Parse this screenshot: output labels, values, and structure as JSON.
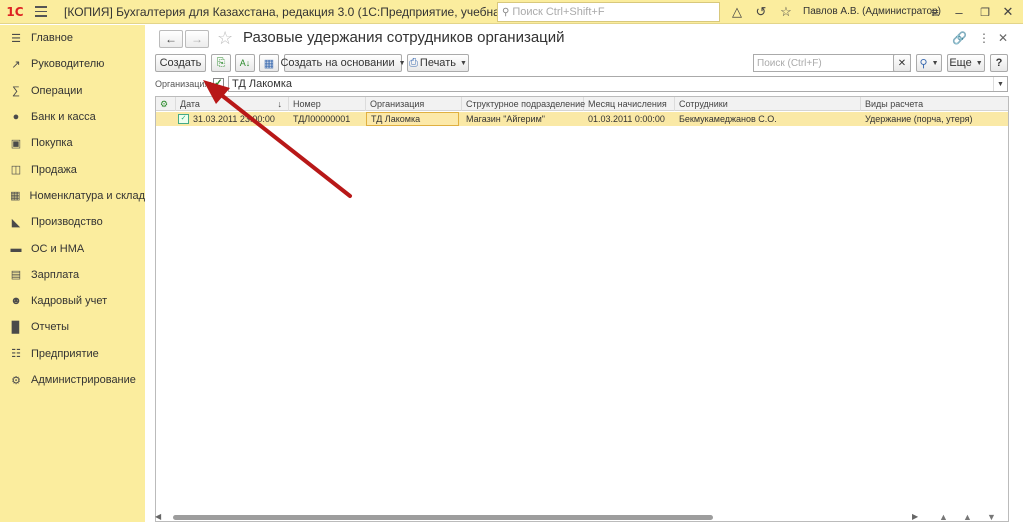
{
  "titlebar": {
    "logo": "1С",
    "title": "[КОПИЯ] Бухгалтерия для Казахстана, редакция 3.0  (1С:Предприятие, учебная версия)",
    "search_placeholder": "Поиск Ctrl+Shift+F",
    "user": "Павлов А.В. (Администратор)"
  },
  "sidebar": {
    "items": [
      {
        "label": "Главное",
        "icon": "menu-icon"
      },
      {
        "label": "Руководителю",
        "icon": "chart-line-icon"
      },
      {
        "label": "Операции",
        "icon": "operations-icon"
      },
      {
        "label": "Банк и касса",
        "icon": "bank-icon"
      },
      {
        "label": "Покупка",
        "icon": "purchase-icon"
      },
      {
        "label": "Продажа",
        "icon": "cart-icon"
      },
      {
        "label": "Номенклатура и склад",
        "icon": "warehouse-icon"
      },
      {
        "label": "Производство",
        "icon": "production-icon"
      },
      {
        "label": "ОС и НМА",
        "icon": "truck-icon"
      },
      {
        "label": "Зарплата",
        "icon": "salary-icon"
      },
      {
        "label": "Кадровый учет",
        "icon": "people-icon"
      },
      {
        "label": "Отчеты",
        "icon": "reports-icon"
      },
      {
        "label": "Предприятие",
        "icon": "enterprise-icon"
      },
      {
        "label": "Администрирование",
        "icon": "gear-icon"
      }
    ]
  },
  "main": {
    "title": "Разовые удержания сотрудников организаций",
    "toolbar": {
      "create": "Создать",
      "create_based": "Создать на основании",
      "print": "Печать",
      "search_placeholder": "Поиск (Ctrl+F)",
      "more": "Еще",
      "help": "?"
    },
    "filter": {
      "label": "Организация:",
      "checked": true,
      "value": "ТД Лакомка"
    },
    "table": {
      "columns": [
        "Дата",
        "Номер",
        "Организация",
        "Структурное подразделение",
        "Месяц начисления",
        "Сотрудники",
        "Виды расчета"
      ],
      "rows": [
        {
          "date": "31.03.2011 23:00:00",
          "number": "ТДЛ00000001",
          "organization": "ТД Лакомка",
          "department": "Магазин \"Айгерим\"",
          "month": "01.03.2011 0:00:00",
          "employees": "Бекмукамеджанов С.О.",
          "calc_types": "Удержание (порча, утеря)"
        }
      ]
    }
  },
  "colors": {
    "sidebar_bg": "#fbed9e",
    "selected_row": "#fae9a6",
    "annotation_arrow": "#b81818"
  }
}
